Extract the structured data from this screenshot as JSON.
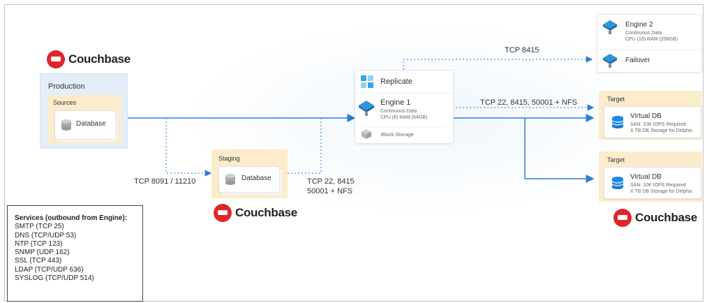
{
  "logos": {
    "brand": "Couchbase"
  },
  "production": {
    "title": "Production",
    "sources_title": "Sources",
    "database": "Database"
  },
  "staging": {
    "title": "Staging",
    "database": "Database"
  },
  "engine1": {
    "replicate": "Replicate",
    "name": "Engine 1",
    "line1": "Continuous Data",
    "line2": "CPU (8) RAM (64GB)",
    "storage": "Block Storage"
  },
  "engine2": {
    "name": "Engine 2",
    "line1": "Continuous Data",
    "line2": "CPU (16) RAM (256GB)",
    "failover": "Failover"
  },
  "targets": [
    {
      "title": "Target",
      "name": "Virtual DB",
      "line1": "SAN: 10K IOPS Required",
      "line2": "X TB DB Storage for Delphix"
    },
    {
      "title": "Target",
      "name": "Virtual DB",
      "line1": "SAN: 10K IOPS Required",
      "line2": "X TB DB Storage for Delphix"
    }
  ],
  "edges": {
    "to_staging": "TCP 8091 / 11210",
    "staging_to_engine_1": "TCP 22, 8415",
    "staging_to_engine_2": "50001 + NFS",
    "to_failover": "TCP 8415",
    "to_target": "TCP 22, 8415, 50001 + NFS"
  },
  "services": {
    "header": "Services (outbound from Engine):",
    "items": [
      "SMTP (TCP 25)",
      "DNS (TCP/UDP 53)",
      "NTP (TCP 123)",
      "SNMP (UDP 162)",
      "SSL (TCP 443)",
      "LDAP (TCP/UDP 636)",
      "SYSLOG (TCP/UDP 514)"
    ]
  },
  "colors": {
    "flow_line": "#2f7bd6",
    "dotted_line": "#4a8fd8",
    "production_bg": "#e3eef9",
    "sources_bg": "#fbeccb",
    "brand_red": "#e0262a"
  }
}
